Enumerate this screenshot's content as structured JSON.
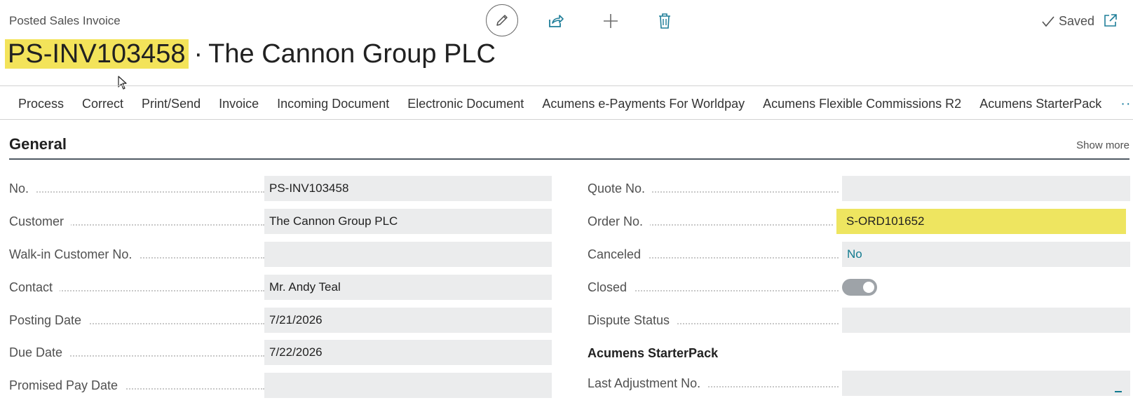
{
  "page": {
    "caption": "Posted Sales Invoice",
    "doc_no": "PS-INV103458",
    "separator": "·",
    "customer_name": "The Cannon Group PLC",
    "saved_label": "Saved"
  },
  "actions": {
    "edit_icon": "pencil-icon",
    "share_icon": "share-icon",
    "new_icon": "plus-icon",
    "delete_icon": "trash-icon",
    "popout_icon": "popout-icon"
  },
  "menu": [
    "Process",
    "Correct",
    "Print/Send",
    "Invoice",
    "Incoming Document",
    "Electronic Document",
    "Acumens e-Payments For Worldpay",
    "Acumens Flexible Commissions R2",
    "Acumens StarterPack",
    "···"
  ],
  "general": {
    "title": "General",
    "show_more": "Show more",
    "left": [
      {
        "label": "No.",
        "value": "PS-INV103458"
      },
      {
        "label": "Customer",
        "value": "The Cannon Group PLC"
      },
      {
        "label": "Walk-in Customer No.",
        "value": ""
      },
      {
        "label": "Contact",
        "value": "Mr. Andy Teal"
      },
      {
        "label": "Posting Date",
        "value": "7/21/2026"
      },
      {
        "label": "Due Date",
        "value": "7/22/2026"
      },
      {
        "label": "Promised Pay Date",
        "value": ""
      }
    ],
    "right": {
      "quote_no": {
        "label": "Quote No.",
        "value": ""
      },
      "order_no": {
        "label": "Order No.",
        "value": "S-ORD101652"
      },
      "canceled": {
        "label": "Canceled",
        "value": "No"
      },
      "closed": {
        "label": "Closed",
        "value": true
      },
      "dispute_status": {
        "label": "Dispute Status",
        "value": ""
      },
      "starterpack_heading": "Acumens StarterPack",
      "last_adjustment_no": {
        "label": "Last Adjustment No.",
        "value": ""
      }
    }
  },
  "colors": {
    "highlight": "#f3e35a",
    "accent": "#127a8f"
  }
}
